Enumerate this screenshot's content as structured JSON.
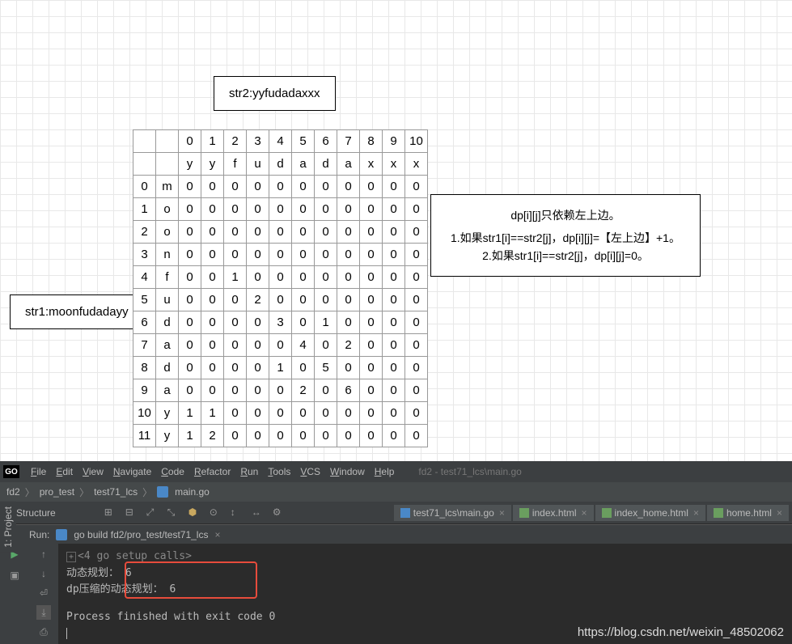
{
  "labels": {
    "str1": "str1:moonfudadayy",
    "str2": "str2:yyfudadaxxx"
  },
  "explanation": {
    "line1": "dp[i][j]只依赖左上边。",
    "line2": "1.如果str1[i]==str2[j]，dp[i][j]=【左上边】+1。",
    "line3": "2.如果str1[i]==str2[j]，dp[i][j]=0。"
  },
  "chart_data": {
    "type": "table",
    "col_index": [
      "0",
      "1",
      "2",
      "3",
      "4",
      "5",
      "6",
      "7",
      "8",
      "9",
      "10"
    ],
    "col_chars": [
      "y",
      "y",
      "f",
      "u",
      "d",
      "a",
      "d",
      "a",
      "x",
      "x",
      "x"
    ],
    "row_index": [
      "0",
      "1",
      "2",
      "3",
      "4",
      "5",
      "6",
      "7",
      "8",
      "9",
      "10",
      "11"
    ],
    "row_chars": [
      "m",
      "o",
      "o",
      "n",
      "f",
      "u",
      "d",
      "a",
      "d",
      "a",
      "y",
      "y"
    ],
    "values": [
      [
        0,
        0,
        0,
        0,
        0,
        0,
        0,
        0,
        0,
        0,
        0
      ],
      [
        0,
        0,
        0,
        0,
        0,
        0,
        0,
        0,
        0,
        0,
        0
      ],
      [
        0,
        0,
        0,
        0,
        0,
        0,
        0,
        0,
        0,
        0,
        0
      ],
      [
        0,
        0,
        0,
        0,
        0,
        0,
        0,
        0,
        0,
        0,
        0
      ],
      [
        0,
        0,
        1,
        0,
        0,
        0,
        0,
        0,
        0,
        0,
        0
      ],
      [
        0,
        0,
        0,
        2,
        0,
        0,
        0,
        0,
        0,
        0,
        0
      ],
      [
        0,
        0,
        0,
        0,
        3,
        0,
        1,
        0,
        0,
        0,
        0
      ],
      [
        0,
        0,
        0,
        0,
        0,
        4,
        0,
        2,
        0,
        0,
        0
      ],
      [
        0,
        0,
        0,
        0,
        1,
        0,
        5,
        0,
        0,
        0,
        0
      ],
      [
        0,
        0,
        0,
        0,
        0,
        2,
        0,
        6,
        0,
        0,
        0
      ],
      [
        1,
        1,
        0,
        0,
        0,
        0,
        0,
        0,
        0,
        0,
        0
      ],
      [
        1,
        2,
        0,
        0,
        0,
        0,
        0,
        0,
        0,
        0,
        0
      ]
    ]
  },
  "ide": {
    "menu": [
      "File",
      "Edit",
      "View",
      "Navigate",
      "Code",
      "Refactor",
      "Run",
      "Tools",
      "VCS",
      "Window",
      "Help"
    ],
    "context": "fd2 - test71_lcs\\main.go",
    "breadcrumb": [
      "fd2",
      "pro_test",
      "test71_lcs",
      "main.go"
    ],
    "structure_label": "Structure",
    "side_project": "1: Project",
    "tabs": [
      {
        "label": "test71_lcs\\main.go",
        "type": "go",
        "active": true
      },
      {
        "label": "index.html",
        "type": "html"
      },
      {
        "label": "index_home.html",
        "type": "html"
      },
      {
        "label": "home.html",
        "type": "html"
      }
    ],
    "run_label": "Run:",
    "run_config": "go build fd2/pro_test/test71_lcs",
    "console": {
      "setup": "<4 go setup calls>",
      "line1": "动态规划： 6",
      "line2": "dp压缩的动态规划： 6",
      "line3": "Process finished with exit code 0"
    }
  },
  "watermark": "https://blog.csdn.net/weixin_48502062"
}
